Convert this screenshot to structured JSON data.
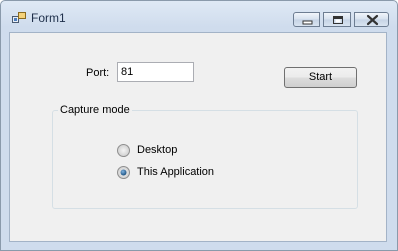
{
  "window": {
    "title": "Form1",
    "controls": {
      "minimize": "minimize-icon",
      "maximize": "maximize-icon",
      "close": "close-icon"
    }
  },
  "form": {
    "port_label": "Port:",
    "port_value": "81",
    "start_label": "Start",
    "capture_mode": {
      "legend": "Capture mode",
      "options": [
        {
          "label": "Desktop",
          "selected": false
        },
        {
          "label": "This Application",
          "selected": true
        }
      ]
    }
  },
  "colors": {
    "accent": "#1c5180",
    "client_bg": "#f0f0f0",
    "frame": "#cfdced"
  }
}
